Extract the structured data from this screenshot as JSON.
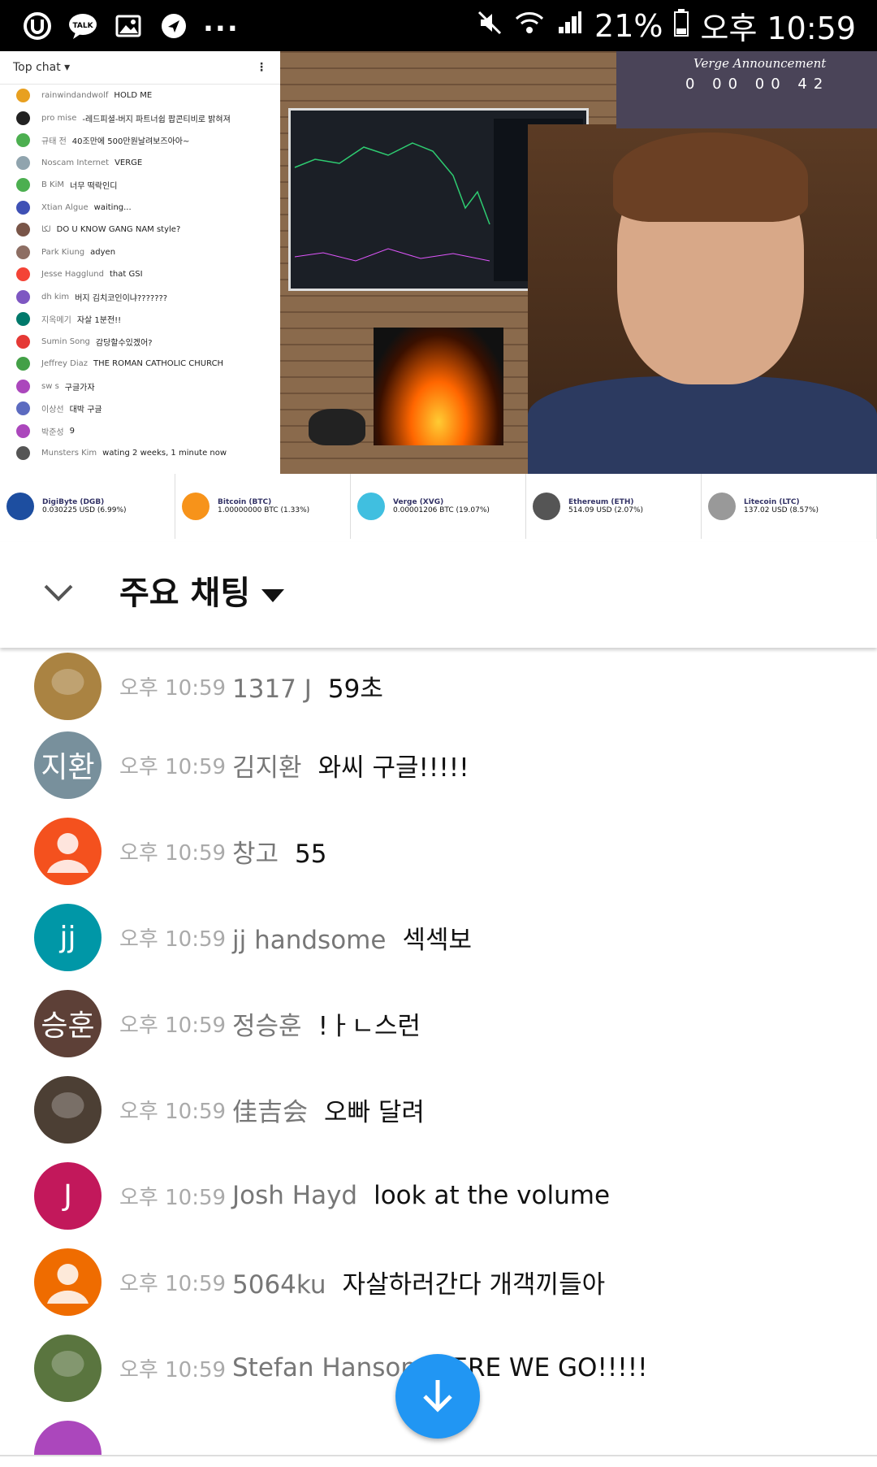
{
  "status_bar": {
    "battery": "21%",
    "time": "오후 10:59",
    "icons": [
      "u-plus-icon",
      "kakaotalk-icon",
      "gallery-icon",
      "navigation-icon",
      "more-dots",
      "mute-icon",
      "wifi-icon",
      "signal-icon",
      "battery-icon"
    ]
  },
  "video": {
    "yt_chat_title": "Top chat",
    "yt_messages": [
      {
        "author": "rainwindandwolf",
        "text": "HOLD ME",
        "color": "#e8a020"
      },
      {
        "author": "pro mise",
        "text": "-레드피셜-버지 파트너쉽 팝콘티비로 밝혀져",
        "color": "#222"
      },
      {
        "author": "규태 전",
        "text": "40조만에 500만원날려보즈아아~",
        "color": "#4caf50"
      },
      {
        "author": "Noscam Internet",
        "text": "VERGE",
        "color": "#90a4ae"
      },
      {
        "author": "B KiM",
        "text": "너무 떡락인디",
        "color": "#4caf50"
      },
      {
        "author": "Xtian Algue",
        "text": "waiting...",
        "color": "#3f51b5"
      },
      {
        "author": "لكا",
        "text": "DO U KNOW GANG NAM style?",
        "color": "#795548"
      },
      {
        "author": "Park Kiung",
        "text": "adyen",
        "color": "#8d6e63"
      },
      {
        "author": "Jesse Hagglund",
        "text": "that GSI",
        "color": "#f44336"
      },
      {
        "author": "dh kim",
        "text": "버지 김치코인이냐???????",
        "color": "#7e57c2"
      },
      {
        "author": "지옥메기",
        "text": "자살 1분전!!",
        "color": "#00796b"
      },
      {
        "author": "Sumin Song",
        "text": "감당할수있겠어?",
        "color": "#e53935"
      },
      {
        "author": "Jeffrey Diaz",
        "text": "THE ROMAN CATHOLIC CHURCH",
        "color": "#43a047"
      },
      {
        "author": "sw s",
        "text": "구글가자",
        "color": "#ab47bc"
      },
      {
        "author": "이상선",
        "text": "대박 구글",
        "color": "#5c6bc0"
      },
      {
        "author": "박준성",
        "text": "9",
        "color": "#ab47bc"
      },
      {
        "author": "Munsters Kim",
        "text": "wating 2 weeks, 1 minute now",
        "color": "#555"
      }
    ],
    "verge_title": "Verge Announcement",
    "verge_countdown": "0 00 00 42",
    "ticker": [
      {
        "name": "DigiByte (DGB)",
        "price": "0.030225 USD (6.99%)",
        "color": "#1d4ea0"
      },
      {
        "name": "Bitcoin (BTC)",
        "price": "1.00000000 BTC (1.33%)",
        "color": "#f7931a"
      },
      {
        "name": "Verge (XVG)",
        "price": "0.00001206 BTC (19.07%)",
        "color": "#40bfe0"
      },
      {
        "name": "Ethereum (ETH)",
        "price": "514.09 USD (2.07%)",
        "color": "#555"
      },
      {
        "name": "Litecoin (LTC)",
        "price": "137.02 USD (8.57%)",
        "color": "#999"
      }
    ]
  },
  "chat_header": {
    "title": "주요 채팅"
  },
  "messages": [
    {
      "time": "오후 10:59",
      "author": "1317 J",
      "text": "59초",
      "avatar_text": "",
      "avatar_color": "#c89a4e",
      "avatar_kind": "photo"
    },
    {
      "time": "오후 10:59",
      "author": "김지환",
      "text": "와씨 구글!!!!!",
      "avatar_text": "지환",
      "avatar_color": "#78909c",
      "avatar_kind": "text"
    },
    {
      "time": "오후 10:59",
      "author": "창고",
      "text": "55",
      "avatar_text": "",
      "avatar_color": "#f4511e",
      "avatar_kind": "person"
    },
    {
      "time": "오후 10:59",
      "author": "jj handsome",
      "text": "섹섹보",
      "avatar_text": "jj",
      "avatar_color": "#0097a7",
      "avatar_kind": "text"
    },
    {
      "time": "오후 10:59",
      "author": "정승훈",
      "text": "!ㅏㄴ스런",
      "avatar_text": "승훈",
      "avatar_color": "#5d4037",
      "avatar_kind": "text"
    },
    {
      "time": "오후 10:59",
      "author": "佳吉会",
      "text": "오빠 달려",
      "avatar_text": "",
      "avatar_color": "#5a4a3e",
      "avatar_kind": "photo"
    },
    {
      "time": "오후 10:59",
      "author": "Josh Hayd",
      "text": "look at the volume",
      "avatar_text": "J",
      "avatar_color": "#c2185b",
      "avatar_kind": "text"
    },
    {
      "time": "오후 10:59",
      "author": "5064ku",
      "text": "자살하러간다 개객끼들아",
      "avatar_text": "",
      "avatar_color": "#ef6c00",
      "avatar_kind": "person"
    },
    {
      "time": "오후 10:59",
      "author": "Stefan Hanson",
      "text": "HERE WE GO!!!!!",
      "avatar_text": "",
      "avatar_color": "#6a8a4a",
      "avatar_kind": "photo"
    },
    {
      "time": "",
      "author": "",
      "text": "",
      "avatar_text": "",
      "avatar_color": "#ab47bc",
      "avatar_kind": "text"
    }
  ]
}
